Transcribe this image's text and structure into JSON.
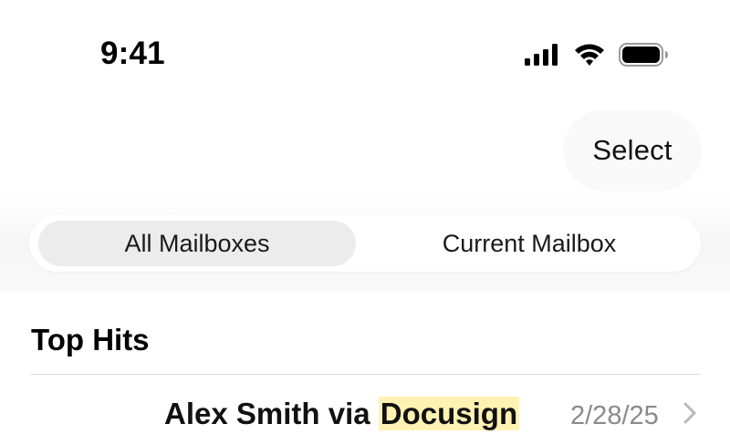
{
  "status_bar": {
    "time": "9:41",
    "icons": [
      "signal-icon",
      "wifi-icon",
      "battery-icon"
    ]
  },
  "header": {
    "select_label": "Select"
  },
  "scope_control": {
    "options": [
      {
        "label": "All Mailboxes",
        "selected": true
      },
      {
        "label": "Current Mailbox",
        "selected": false
      }
    ]
  },
  "results": {
    "section_title": "Top Hits",
    "rows": [
      {
        "sender_prefix": "Alex Smith via ",
        "sender_match": "Docusign",
        "date": "2/28/25"
      }
    ]
  },
  "colors": {
    "match_highlight": "#fff2b3",
    "selected_segment": "#ececec",
    "secondary_text": "#8a8a8a"
  }
}
